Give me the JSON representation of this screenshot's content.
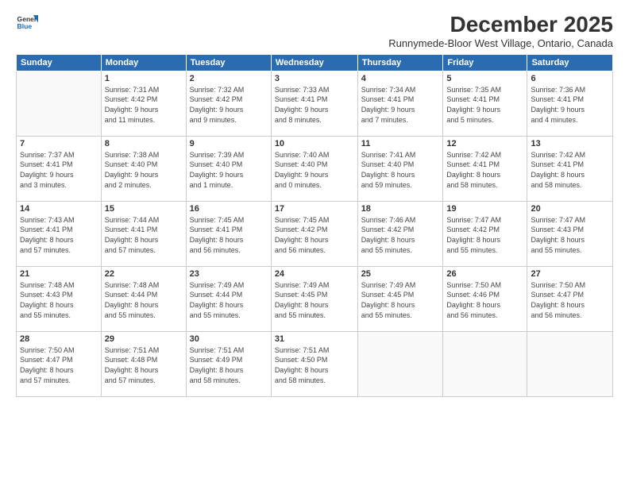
{
  "logo": {
    "line1": "General",
    "line2": "Blue"
  },
  "title": "December 2025",
  "subtitle": "Runnymede-Bloor West Village, Ontario, Canada",
  "weekdays": [
    "Sunday",
    "Monday",
    "Tuesday",
    "Wednesday",
    "Thursday",
    "Friday",
    "Saturday"
  ],
  "weeks": [
    [
      {
        "day": "",
        "info": ""
      },
      {
        "day": "1",
        "info": "Sunrise: 7:31 AM\nSunset: 4:42 PM\nDaylight: 9 hours\nand 11 minutes."
      },
      {
        "day": "2",
        "info": "Sunrise: 7:32 AM\nSunset: 4:42 PM\nDaylight: 9 hours\nand 9 minutes."
      },
      {
        "day": "3",
        "info": "Sunrise: 7:33 AM\nSunset: 4:41 PM\nDaylight: 9 hours\nand 8 minutes."
      },
      {
        "day": "4",
        "info": "Sunrise: 7:34 AM\nSunset: 4:41 PM\nDaylight: 9 hours\nand 7 minutes."
      },
      {
        "day": "5",
        "info": "Sunrise: 7:35 AM\nSunset: 4:41 PM\nDaylight: 9 hours\nand 5 minutes."
      },
      {
        "day": "6",
        "info": "Sunrise: 7:36 AM\nSunset: 4:41 PM\nDaylight: 9 hours\nand 4 minutes."
      }
    ],
    [
      {
        "day": "7",
        "info": "Sunrise: 7:37 AM\nSunset: 4:41 PM\nDaylight: 9 hours\nand 3 minutes."
      },
      {
        "day": "8",
        "info": "Sunrise: 7:38 AM\nSunset: 4:40 PM\nDaylight: 9 hours\nand 2 minutes."
      },
      {
        "day": "9",
        "info": "Sunrise: 7:39 AM\nSunset: 4:40 PM\nDaylight: 9 hours\nand 1 minute."
      },
      {
        "day": "10",
        "info": "Sunrise: 7:40 AM\nSunset: 4:40 PM\nDaylight: 9 hours\nand 0 minutes."
      },
      {
        "day": "11",
        "info": "Sunrise: 7:41 AM\nSunset: 4:40 PM\nDaylight: 8 hours\nand 59 minutes."
      },
      {
        "day": "12",
        "info": "Sunrise: 7:42 AM\nSunset: 4:41 PM\nDaylight: 8 hours\nand 58 minutes."
      },
      {
        "day": "13",
        "info": "Sunrise: 7:42 AM\nSunset: 4:41 PM\nDaylight: 8 hours\nand 58 minutes."
      }
    ],
    [
      {
        "day": "14",
        "info": "Sunrise: 7:43 AM\nSunset: 4:41 PM\nDaylight: 8 hours\nand 57 minutes."
      },
      {
        "day": "15",
        "info": "Sunrise: 7:44 AM\nSunset: 4:41 PM\nDaylight: 8 hours\nand 57 minutes."
      },
      {
        "day": "16",
        "info": "Sunrise: 7:45 AM\nSunset: 4:41 PM\nDaylight: 8 hours\nand 56 minutes."
      },
      {
        "day": "17",
        "info": "Sunrise: 7:45 AM\nSunset: 4:42 PM\nDaylight: 8 hours\nand 56 minutes."
      },
      {
        "day": "18",
        "info": "Sunrise: 7:46 AM\nSunset: 4:42 PM\nDaylight: 8 hours\nand 55 minutes."
      },
      {
        "day": "19",
        "info": "Sunrise: 7:47 AM\nSunset: 4:42 PM\nDaylight: 8 hours\nand 55 minutes."
      },
      {
        "day": "20",
        "info": "Sunrise: 7:47 AM\nSunset: 4:43 PM\nDaylight: 8 hours\nand 55 minutes."
      }
    ],
    [
      {
        "day": "21",
        "info": "Sunrise: 7:48 AM\nSunset: 4:43 PM\nDaylight: 8 hours\nand 55 minutes."
      },
      {
        "day": "22",
        "info": "Sunrise: 7:48 AM\nSunset: 4:44 PM\nDaylight: 8 hours\nand 55 minutes."
      },
      {
        "day": "23",
        "info": "Sunrise: 7:49 AM\nSunset: 4:44 PM\nDaylight: 8 hours\nand 55 minutes."
      },
      {
        "day": "24",
        "info": "Sunrise: 7:49 AM\nSunset: 4:45 PM\nDaylight: 8 hours\nand 55 minutes."
      },
      {
        "day": "25",
        "info": "Sunrise: 7:49 AM\nSunset: 4:45 PM\nDaylight: 8 hours\nand 55 minutes."
      },
      {
        "day": "26",
        "info": "Sunrise: 7:50 AM\nSunset: 4:46 PM\nDaylight: 8 hours\nand 56 minutes."
      },
      {
        "day": "27",
        "info": "Sunrise: 7:50 AM\nSunset: 4:47 PM\nDaylight: 8 hours\nand 56 minutes."
      }
    ],
    [
      {
        "day": "28",
        "info": "Sunrise: 7:50 AM\nSunset: 4:47 PM\nDaylight: 8 hours\nand 57 minutes."
      },
      {
        "day": "29",
        "info": "Sunrise: 7:51 AM\nSunset: 4:48 PM\nDaylight: 8 hours\nand 57 minutes."
      },
      {
        "day": "30",
        "info": "Sunrise: 7:51 AM\nSunset: 4:49 PM\nDaylight: 8 hours\nand 58 minutes."
      },
      {
        "day": "31",
        "info": "Sunrise: 7:51 AM\nSunset: 4:50 PM\nDaylight: 8 hours\nand 58 minutes."
      },
      {
        "day": "",
        "info": ""
      },
      {
        "day": "",
        "info": ""
      },
      {
        "day": "",
        "info": ""
      }
    ]
  ]
}
